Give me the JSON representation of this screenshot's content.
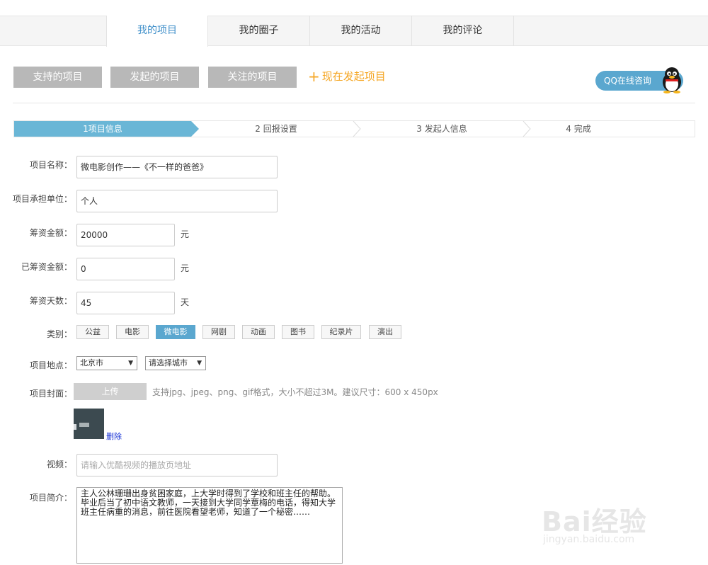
{
  "tabs": [
    {
      "label": "我的项目",
      "active": true
    },
    {
      "label": "我的圈子",
      "active": false
    },
    {
      "label": "我的活动",
      "active": false
    },
    {
      "label": "我的评论",
      "active": false
    }
  ],
  "subnav": {
    "supported": "支持的项目",
    "launched": "发起的项目",
    "followed": "关注的项目",
    "launch_now": "现在发起项目"
  },
  "qq": {
    "label": "QQ在线咨询"
  },
  "steps": [
    {
      "label": "1项目信息",
      "active": true
    },
    {
      "label": "2 回报设置",
      "active": false
    },
    {
      "label": "3 发起人信息",
      "active": false
    },
    {
      "label": "4 完成",
      "active": false
    }
  ],
  "form": {
    "name": {
      "label": "项目名称：",
      "value": "微电影创作——《不一样的爸爸》"
    },
    "org": {
      "label": "项目承担单位：",
      "value": "个人"
    },
    "goal": {
      "label": "筹资金额：",
      "value": "20000",
      "unit": "元"
    },
    "raised": {
      "label": "已筹资金额：",
      "value": "0",
      "unit": "元"
    },
    "days": {
      "label": "筹资天数：",
      "value": "45",
      "unit": "天"
    },
    "category": {
      "label": "类别：",
      "options": [
        "公益",
        "电影",
        "微电影",
        "网剧",
        "动画",
        "图书",
        "纪录片",
        "演出"
      ],
      "selected": "微电影"
    },
    "location": {
      "label": "项目地点：",
      "province": "北京市",
      "city": "请选择城市"
    },
    "cover": {
      "label": "项目封面：",
      "upload_label": "上传",
      "hint": "支持jpg、jpeg、png、gif格式，大小不超过3M。建议尺寸：600 x 450px",
      "delete_label": "删除"
    },
    "video": {
      "label": "视频：",
      "placeholder": "请输入优酷视频的播放页地址"
    },
    "intro": {
      "label": "项目简介：",
      "value": "主人公林珊珊出身贫困家庭，上大学时得到了学校和班主任的帮助。毕业后当了初中语文教师，一天接到大学同学覃梅的电话，得知大学班主任病重的消息，前往医院看望老师，知道了一个秘密……"
    }
  },
  "watermark": {
    "main": "Bai经验",
    "sub": "jingyan.baidu.com"
  },
  "colors": {
    "accent": "#5aa7cf",
    "step_active": "#6ab6d6",
    "launch": "#f5a623",
    "tab_active_text": "#3d8ec9"
  }
}
